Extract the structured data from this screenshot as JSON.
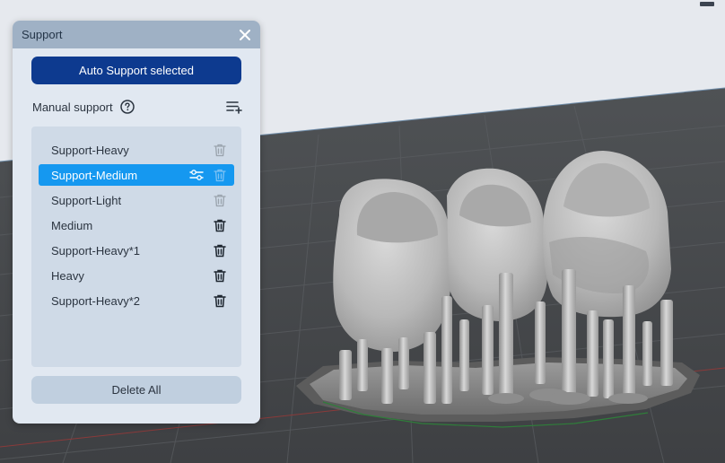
{
  "panel": {
    "title": "Support",
    "auto_support_label": "Auto Support selected",
    "manual_support_label": "Manual support",
    "delete_all_label": "Delete All",
    "items": [
      {
        "label": "Support-Heavy",
        "selected": false,
        "deletable": false
      },
      {
        "label": "Support-Medium",
        "selected": true,
        "deletable": false
      },
      {
        "label": "Support-Light",
        "selected": false,
        "deletable": false
      },
      {
        "label": "Medium",
        "selected": false,
        "deletable": true
      },
      {
        "label": "Support-Heavy*1",
        "selected": false,
        "deletable": true
      },
      {
        "label": "Heavy",
        "selected": false,
        "deletable": true
      },
      {
        "label": "Support-Heavy*2",
        "selected": false,
        "deletable": true
      }
    ]
  },
  "colors": {
    "header_bg": "#9fb1c5",
    "panel_bg": "#e1e8f1",
    "primary_button": "#0d3a8f",
    "selected_row": "#1598f0",
    "viewport_bg": "#e6e9ee",
    "build_plate": "#4a4c4f"
  },
  "icons": {
    "close": "close-icon",
    "help": "help-circle-icon",
    "add_list": "add-list-icon",
    "delete": "trash-icon",
    "settings": "sliders-icon"
  }
}
